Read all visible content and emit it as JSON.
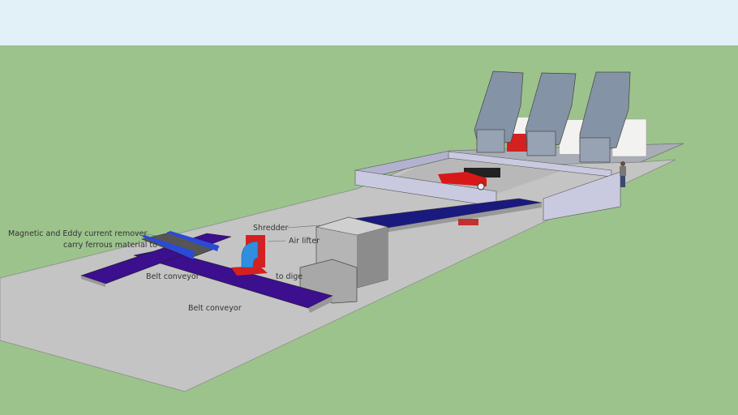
{
  "labels": {
    "magnetic": "Magnetic and Eddy current remover",
    "ferrous": "carry ferrous material to",
    "shredder": "Shredder",
    "air_lifter": "Air lifter",
    "belt_conveyor_upper": "Belt conveyor",
    "to_digester": "to dige",
    "belt_conveyor_lower": "Belt conveyor"
  },
  "colors": {
    "sky": "#e2f1f8",
    "ground": "#9cc38c",
    "slab": "#c4c4c4",
    "conveyor": "#3b0f8e",
    "air_lifter": "#2f8ee0",
    "flange": "#d42020",
    "truck_bed": "#8593a6",
    "wall": "#c9c9e0"
  }
}
